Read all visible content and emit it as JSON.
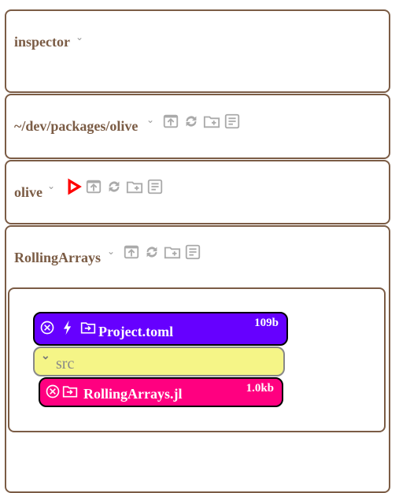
{
  "panels": [
    {
      "title": "inspector"
    },
    {
      "title": "~/dev/packages/olive"
    },
    {
      "title": "olive"
    },
    {
      "title": "RollingArrays"
    }
  ],
  "files": {
    "project": {
      "name": "Project.toml",
      "size": "109b",
      "color": "#6600ff"
    },
    "src": {
      "name": "src",
      "color": "#f5f587"
    },
    "rolling": {
      "name": "RollingArrays.jl",
      "size": "1.0kb",
      "color": "#ff0080"
    }
  },
  "colors": {
    "border": "#7b5c45",
    "run": "#ff0000",
    "icon": "#aaaaaa"
  }
}
